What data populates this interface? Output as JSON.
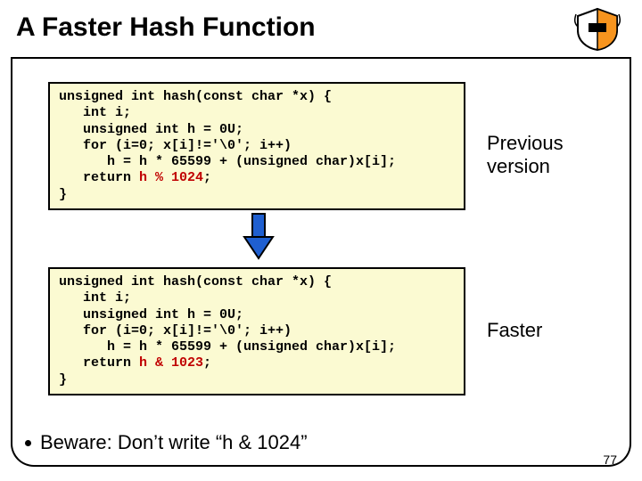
{
  "title": "A Faster Hash Function",
  "code1": {
    "l1": "unsigned int hash(const char *x) {",
    "l2": "   int i;",
    "l3": "   unsigned int h = 0U;",
    "l4": "   for (i=0; x[i]!='\\0'; i++)",
    "l5": "      h = h * 65599 + (unsigned char)x[i];",
    "l6a": "   return ",
    "l6b": "h % 1024",
    "l6c": ";",
    "l7": "}"
  },
  "code2": {
    "l1": "unsigned int hash(const char *x) {",
    "l2": "   int i;",
    "l3": "   unsigned int h = 0U;",
    "l4": "   for (i=0; x[i]!='\\0'; i++)",
    "l5": "      h = h * 65599 + (unsigned char)x[i];",
    "l6a": "   return ",
    "l6b": "h & 1023",
    "l6c": ";",
    "l7": "}"
  },
  "annot1": "Previous version",
  "annot2": "Faster",
  "bullet": "Beware: Don’t write “h & 1024”",
  "pagenum": "77"
}
